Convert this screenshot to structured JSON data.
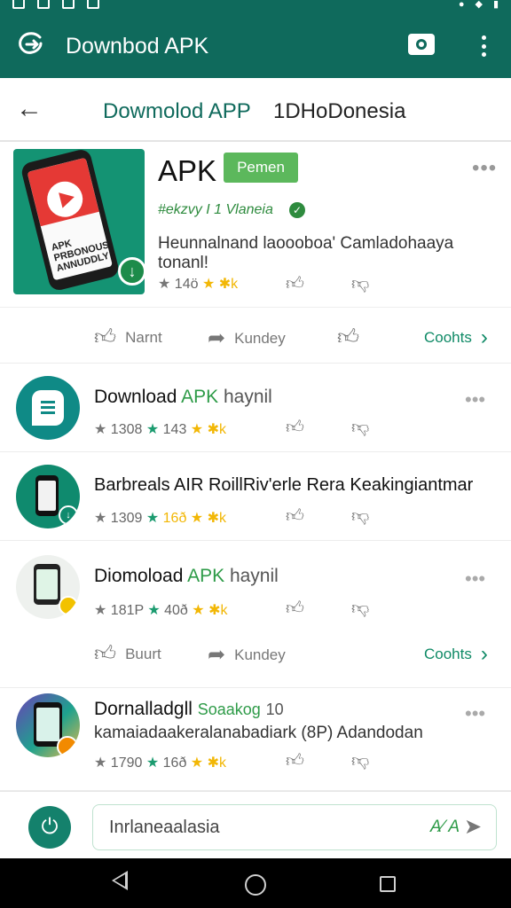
{
  "appbar": {
    "title": "Downbod APK",
    "icons": [
      "brand-logo-icon",
      "camera-icon",
      "more-vertical-icon"
    ]
  },
  "subbar": {
    "title": "Dowmolod APP",
    "region": "1DHoDonesia"
  },
  "hero": {
    "app_name": "APK",
    "badge": "Pemen",
    "developer": "#ekzvy I 1 Vlaneia",
    "description": "Heunnalnand laoooboa' Camladohaaya tonanl!",
    "rating": "14ö",
    "stars_text": "★ ✱k",
    "thumb_text": "APK PRBONOUSNA ANNUDDLY",
    "actions": {
      "like": "Narnt",
      "share": "Kundey",
      "details": "Coohts"
    }
  },
  "items": [
    {
      "name": "Download",
      "name_green": "APK",
      "name_suffix": "haynil",
      "rating": "1308",
      "count": "143",
      "stars_text": "★ ✱k"
    },
    {
      "name": "Barbreals AIR RoillRiv'erle Rera Keakingiantmar",
      "name_green": "",
      "name_suffix": "",
      "rating": "1309",
      "count": "16ð",
      "stars_text": "★ ✱k"
    },
    {
      "name": "Diomoload",
      "name_green": "APK",
      "name_suffix": "haynil",
      "rating": "181P",
      "count": "40ð",
      "stars_text": "★ ✱k",
      "actions": {
        "like": "Buurt",
        "share": "Kundey",
        "details": "Coohts"
      }
    },
    {
      "name": "Dornalladgll",
      "name_green": "Soaakog",
      "name_suffix": "10",
      "subtitle": "kamaiadaakeralanabadiark (8P) Adandodan",
      "rating": "1790",
      "count": "16ð",
      "stars_text": "★ ✱k"
    }
  ],
  "composer": {
    "value": "Inrlaneaalasia",
    "translate": "A⁄ A",
    "icons": [
      "power-icon",
      "send-icon"
    ]
  },
  "navbar": {
    "icons": [
      "back-icon",
      "home-icon",
      "recent-apps-icon"
    ]
  }
}
